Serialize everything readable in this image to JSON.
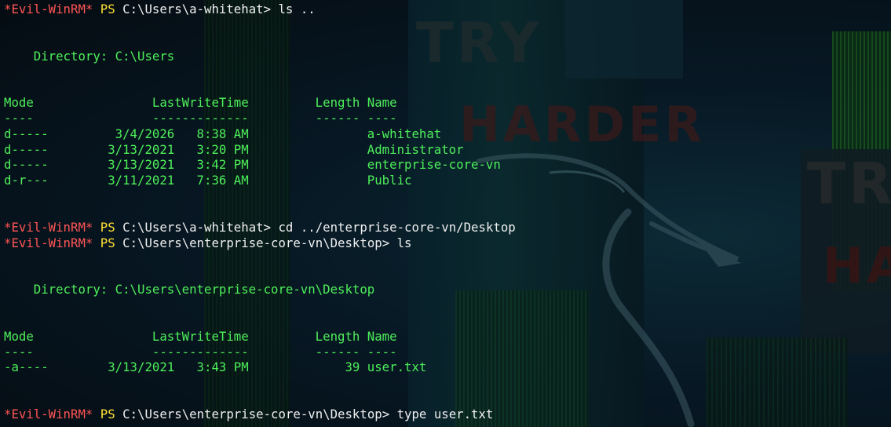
{
  "terminal": {
    "shell_tag": "*Evil-WinRM*",
    "ps_label": "PS"
  },
  "wallpaper": {
    "watermarks": [
      "TRY",
      "HARDER",
      "TRY",
      "HA"
    ],
    "logo": "kali-dragon"
  },
  "colors": {
    "background": "#061018",
    "prompt_tag": "#ff5555",
    "ps": "#ffe135",
    "output": "#4ef05a",
    "command": "#f0f0f0"
  },
  "blocks": [
    {
      "prompt_path": "C:\\Users\\a-whitehat>",
      "command": " ls ..",
      "directory": "    Directory: C:\\Users",
      "header": "Mode                LastWriteTime         Length Name",
      "rule": "----                -------------         ------ ----",
      "rows": [
        "d-----         3/4/2026   8:38 AM                a-whitehat",
        "d-----        3/13/2021   3:20 PM                Administrator",
        "d-----        3/13/2021   3:42 PM                enterprise-core-vn",
        "d-r---        3/11/2021   7:36 AM                Public"
      ]
    },
    {
      "prompt_path": "C:\\Users\\a-whitehat>",
      "command": " cd ../enterprise-core-vn/Desktop"
    },
    {
      "prompt_path": "C:\\Users\\enterprise-core-vn\\Desktop>",
      "command": " ls",
      "directory": "    Directory: C:\\Users\\enterprise-core-vn\\Desktop",
      "header": "Mode                LastWriteTime         Length Name",
      "rule": "----                -------------         ------ ----",
      "rows": [
        "-a----        3/13/2021   3:43 PM             39 user.txt"
      ]
    },
    {
      "prompt_path": "C:\\Users\\enterprise-core-vn\\Desktop>",
      "command": " type user.txt"
    }
  ]
}
